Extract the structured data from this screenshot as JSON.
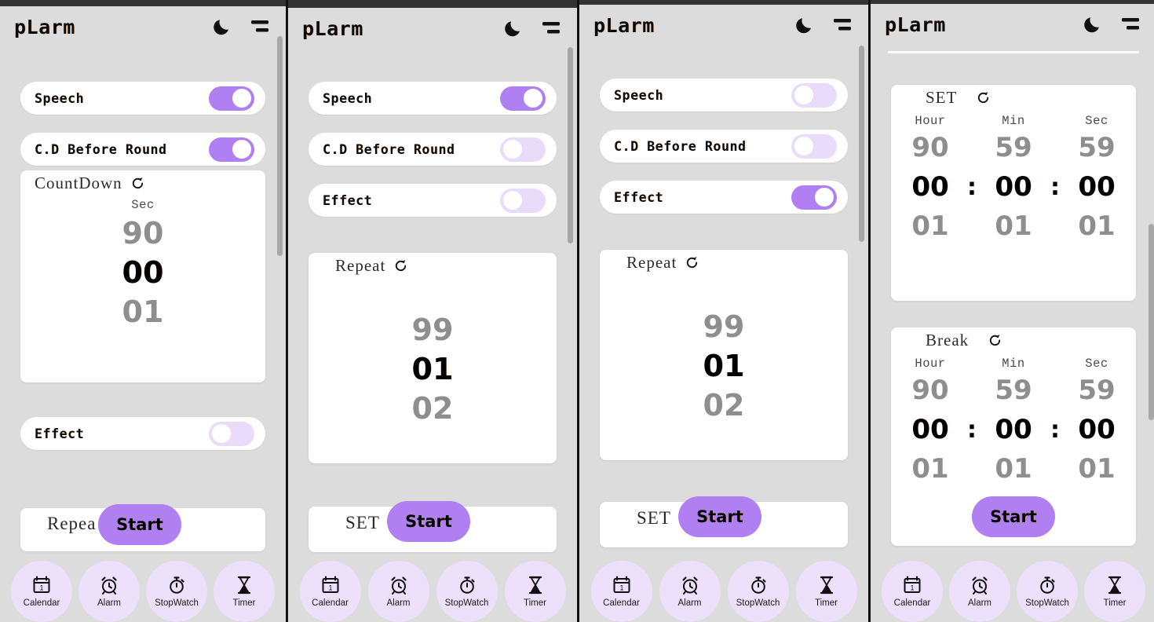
{
  "app": {
    "title": "pLarm",
    "icons": {
      "theme": "moon-icon",
      "menu": "menu-icon",
      "refresh": "refresh-icon"
    },
    "colors": {
      "accent": "#b07ff2",
      "toggle_off": "#e8dcfa",
      "nav_bubble": "#ece0fb",
      "page_bg": "#dcdcdc",
      "card_bg": "#ffffff",
      "topbar": "#333333",
      "wheel_dim": "#8e8e8e",
      "wheel_active": "#000000"
    }
  },
  "labels": {
    "speech": "Speech",
    "cd_before_round": "C.D Before Round",
    "effect": "Effect",
    "countdown": "CountDown",
    "repeat": "Repeat",
    "set": "SET",
    "break": "Break",
    "start": "Start",
    "hour": "Hour",
    "min": "Min",
    "sec": "Sec",
    "colon": ":"
  },
  "bottom_nav": [
    {
      "label": "Calendar",
      "icon": "calendar-icon"
    },
    {
      "label": "Alarm",
      "icon": "alarm-clock-icon"
    },
    {
      "label": "StopWatch",
      "icon": "stopwatch-icon"
    },
    {
      "label": "Timer",
      "icon": "hourglass-icon"
    }
  ],
  "panels": [
    {
      "id": "panel-1",
      "toggles": [
        {
          "label": "Speech",
          "state": "on"
        },
        {
          "label": "C.D Before Round",
          "state": "on"
        }
      ],
      "countdown_picker": {
        "title": "CountDown",
        "columns": [
          {
            "head": "Sec",
            "top": "90",
            "mid": "00",
            "bot": "01"
          }
        ]
      },
      "effect_toggle": {
        "label": "Effect",
        "state": "off"
      },
      "partial_card_label": "Repea",
      "start": "Start"
    },
    {
      "id": "panel-2",
      "toggles": [
        {
          "label": "Speech",
          "state": "on"
        },
        {
          "label": "C.D Before Round",
          "state": "off"
        },
        {
          "label": "Effect",
          "state": "off"
        }
      ],
      "repeat_picker": {
        "title": "Repeat",
        "columns": [
          {
            "head": "",
            "top": "99",
            "mid": "01",
            "bot": "02"
          }
        ]
      },
      "partial_card_label": "SET",
      "start": "Start"
    },
    {
      "id": "panel-3",
      "toggles": [
        {
          "label": "Speech",
          "state": "off"
        },
        {
          "label": "C.D Before Round",
          "state": "off"
        },
        {
          "label": "Effect",
          "state": "on"
        }
      ],
      "repeat_picker": {
        "title": "Repeat",
        "columns": [
          {
            "head": "",
            "top": "99",
            "mid": "01",
            "bot": "02"
          }
        ]
      },
      "partial_card_label": "SET",
      "start": "Start"
    },
    {
      "id": "panel-4",
      "set_picker": {
        "title": "SET",
        "columns": [
          {
            "head": "Hour",
            "top": "90",
            "mid": "00",
            "bot": "01"
          },
          {
            "head": "Min",
            "top": "59",
            "mid": "00",
            "bot": "01"
          },
          {
            "head": "Sec",
            "top": "59",
            "mid": "00",
            "bot": "01"
          }
        ]
      },
      "break_picker": {
        "title": "Break",
        "columns": [
          {
            "head": "Hour",
            "top": "90",
            "mid": "00",
            "bot": "01"
          },
          {
            "head": "Min",
            "top": "59",
            "mid": "00",
            "bot": "01"
          },
          {
            "head": "Sec",
            "top": "59",
            "mid": "00",
            "bot": "01"
          }
        ]
      },
      "start": "Start"
    }
  ]
}
